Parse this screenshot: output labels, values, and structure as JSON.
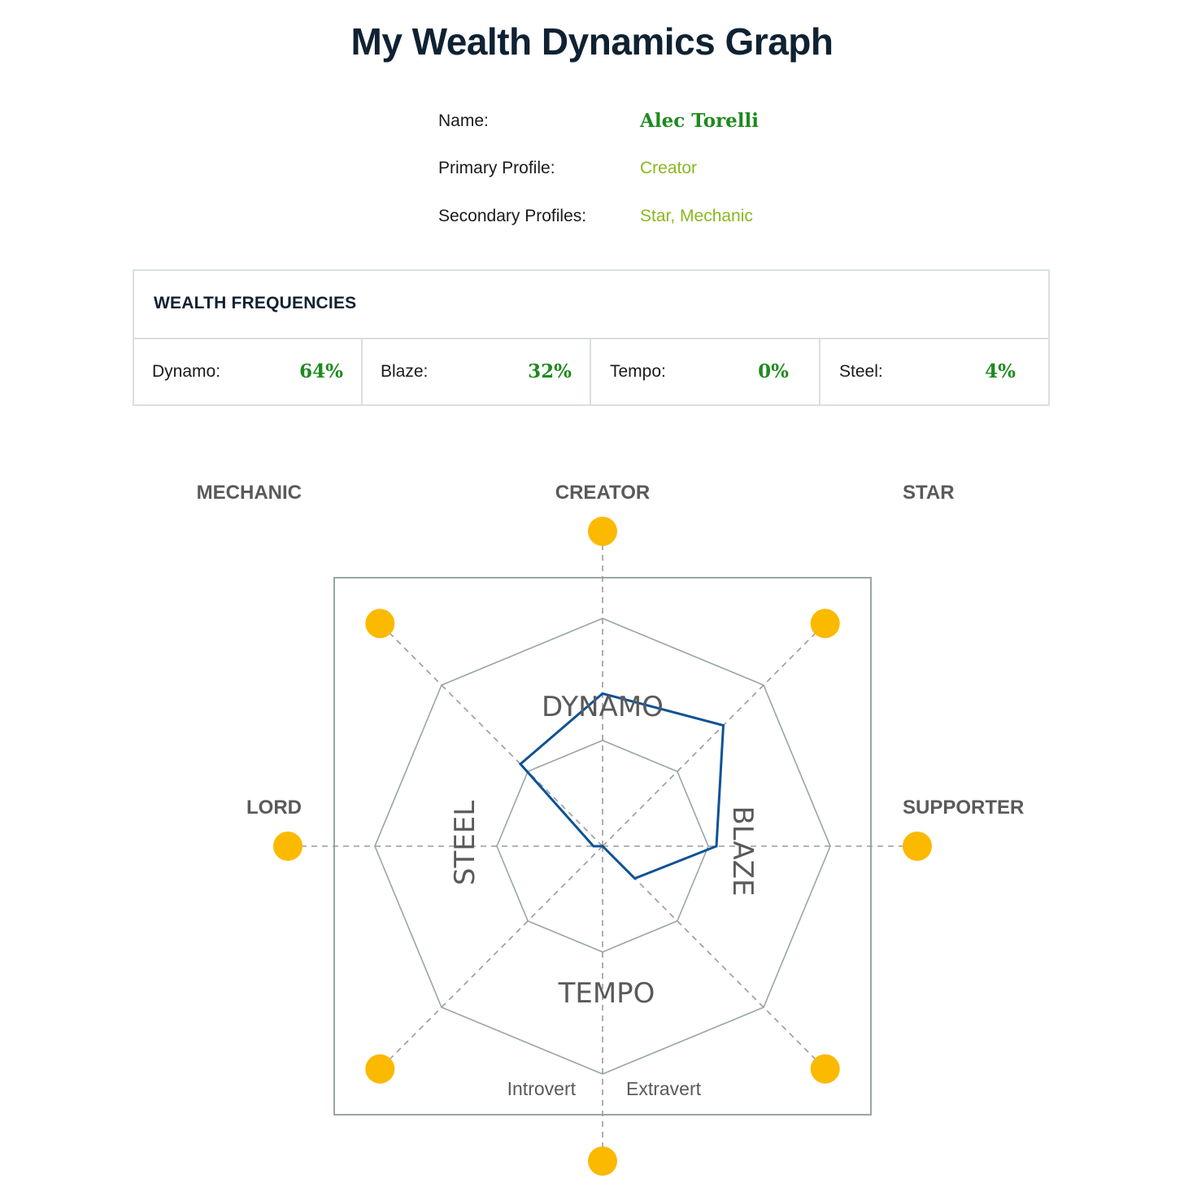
{
  "page": {
    "title": "My Wealth Dynamics Graph"
  },
  "profile": {
    "name_label": "Name:",
    "name_value": "Alec Torelli",
    "primary_label": "Primary Profile:",
    "primary_value": "Creator",
    "secondary_label": "Secondary Profiles:",
    "secondary_value": "Star, Mechanic"
  },
  "frequencies": {
    "title": "WEALTH FREQUENCIES",
    "items": [
      {
        "label": "Dynamo:",
        "value": "64%"
      },
      {
        "label": "Blaze:",
        "value": "32%"
      },
      {
        "label": "Tempo:",
        "value": "0%"
      },
      {
        "label": "Steel:",
        "value": "4%"
      }
    ]
  },
  "colors": {
    "title": "#0f2233",
    "name_value": "#1f8a1f",
    "profile_value": "#8ab81f",
    "percent": "#1f8a1f",
    "marker": "#fbb900",
    "series_line": "#0d5296",
    "grid": "#9aa5a5",
    "axis": "#9b9b9b"
  },
  "chart_data": {
    "type": "radar",
    "title": "",
    "profiles": [
      "CREATOR",
      "STAR",
      "SUPPORTER",
      "",
      "",
      "",
      "LORD",
      "MECHANIC"
    ],
    "frequency_labels": [
      "DYNAMO",
      "BLAZE",
      "TEMPO",
      "STEEL"
    ],
    "axis_labels": [
      "Introvert",
      "Extravert"
    ],
    "rings": 3,
    "series": [
      {
        "values": [
          0.67,
          0.75,
          0.5,
          0.2,
          0.0,
          0.0,
          0.04,
          0.51
        ]
      }
    ]
  }
}
